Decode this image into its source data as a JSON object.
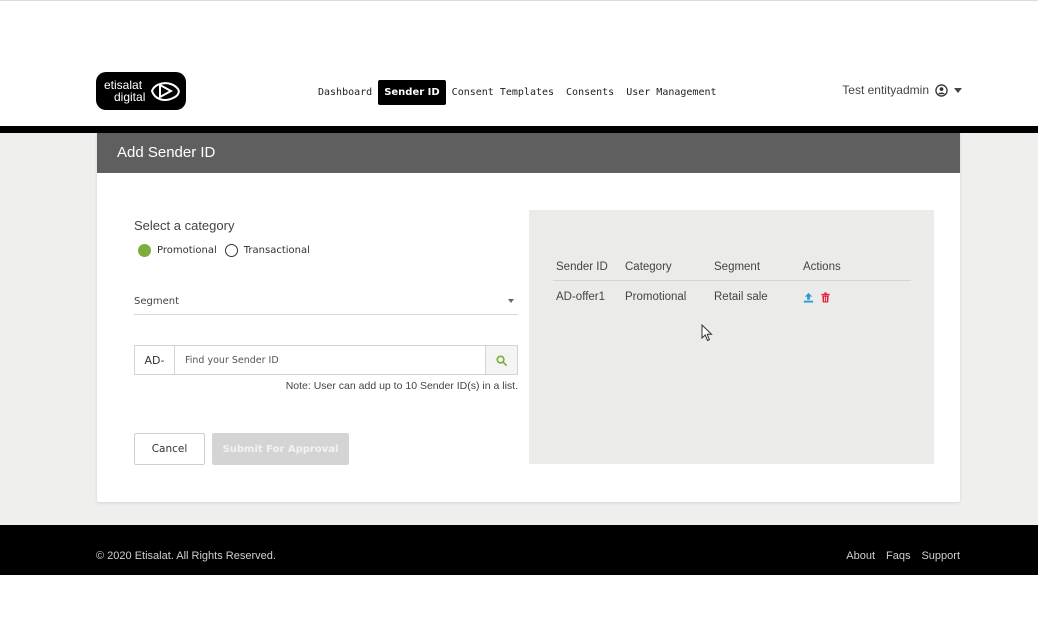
{
  "brand": {
    "line1": "etisalat",
    "line2": "digital"
  },
  "nav": {
    "items": [
      {
        "label": "Dashboard"
      },
      {
        "label": "Sender ID"
      },
      {
        "label": "Consent Templates"
      },
      {
        "label": "Consents"
      },
      {
        "label": "User Management"
      }
    ],
    "active": "Sender ID"
  },
  "user": {
    "name": "Test entityadmin"
  },
  "card": {
    "title": "Add Sender ID"
  },
  "form": {
    "category_title": "Select a category",
    "categories": [
      {
        "label": "Promotional",
        "selected": true
      },
      {
        "label": "Transactional",
        "selected": false
      }
    ],
    "segment_label": "Segment",
    "search": {
      "prefix": "AD-",
      "placeholder": "Find your Sender ID",
      "value": ""
    },
    "note": "Note: User can add up to 10 Sender ID(s) in a list.",
    "cancel_label": "Cancel",
    "submit_label": "Submit For Approval"
  },
  "table": {
    "headers": [
      "Sender ID",
      "Category",
      "Segment",
      "Actions"
    ],
    "rows": [
      {
        "sender_id": "AD-offer1",
        "category": "Promotional",
        "segment": "Retail sale"
      }
    ]
  },
  "footer": {
    "copyright": "© 2020 Etisalat. All Rights Reserved.",
    "links": [
      "About",
      "Faqs",
      "Support"
    ]
  },
  "colors": {
    "accent_green": "#7cad3d",
    "upload_blue": "#2a9ad6",
    "delete_red": "#e0243a",
    "header_gray": "#5f5f5f"
  },
  "icons": [
    "etisalat-logo-icon",
    "user-circle-icon",
    "chevron-down-icon",
    "search-icon",
    "upload-icon",
    "trash-icon",
    "mouse-cursor-icon"
  ]
}
